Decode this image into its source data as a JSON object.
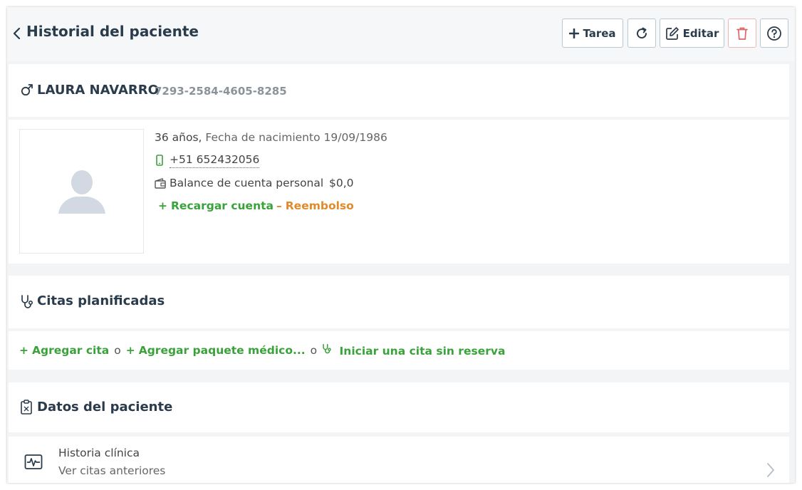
{
  "header": {
    "title": "Historial del paciente",
    "task_button": "Tarea",
    "edit_button": "Editar"
  },
  "patient": {
    "name": "LAURA NAVARRO",
    "id": "7293-2584-4605-8285",
    "age": "36 años,",
    "dob_label": "Fecha de nacimiento",
    "dob": "19/09/1986",
    "phone": "+51 652432056",
    "balance_label": "Balance de cuenta personal",
    "balance_value": "$0,0",
    "recharge_label": "Recargar cuenta",
    "refund_label": "Reembolso"
  },
  "appointments": {
    "title": "Citas planificadas",
    "add_appointment": "Agregar cita",
    "or1": "o",
    "add_package": "Agregar paquete médico...",
    "or2": "o",
    "walk_in": "Iniciar una cita sin reserva"
  },
  "patient_data": {
    "title": "Datos del paciente",
    "history_title": "Historia clínica",
    "history_subtitle": "Ver citas anteriores"
  },
  "colors": {
    "accent_green": "#3aa23a",
    "accent_orange": "#e08a2c",
    "danger": "#e06666",
    "title": "#2a3b4c"
  },
  "icons": [
    "chevron-left-icon",
    "plus-icon",
    "refresh-icon",
    "edit-icon",
    "trash-icon",
    "help-icon",
    "male-icon",
    "user-silhouette-icon",
    "mobile-phone-icon",
    "wallet-icon",
    "stethoscope-icon",
    "clipboard-icon",
    "heartbeat-monitor-icon",
    "chevron-right-icon"
  ]
}
